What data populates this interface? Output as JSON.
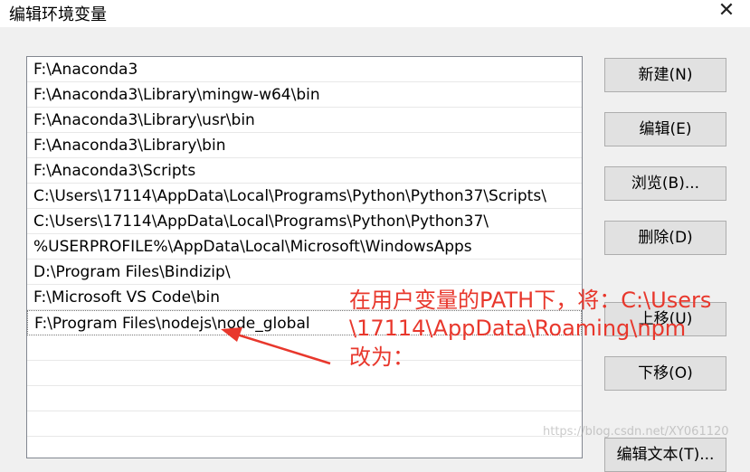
{
  "window": {
    "title": "编辑环境变量",
    "close_glyph": "✕"
  },
  "list": {
    "items": [
      "F:\\Anaconda3",
      "F:\\Anaconda3\\Library\\mingw-w64\\bin",
      "F:\\Anaconda3\\Library\\usr\\bin",
      "F:\\Anaconda3\\Library\\bin",
      "F:\\Anaconda3\\Scripts",
      "C:\\Users\\17114\\AppData\\Local\\Programs\\Python\\Python37\\Scripts\\",
      "C:\\Users\\17114\\AppData\\Local\\Programs\\Python\\Python37\\",
      "%USERPROFILE%\\AppData\\Local\\Microsoft\\WindowsApps",
      "D:\\Program Files\\Bindizip\\",
      "F:\\Microsoft VS Code\\bin",
      "F:\\Program Files\\nodejs\\node_global",
      "",
      "",
      "",
      "",
      ""
    ],
    "selected_index": 10
  },
  "buttons": {
    "new": "新建(N)",
    "edit": "编辑(E)",
    "browse": "浏览(B)...",
    "delete": "删除(D)",
    "move_up": "上移(U)",
    "move_down": "下移(O)",
    "edit_text": "编辑文本(T)..."
  },
  "annotation": {
    "line1": "在用户变量的PATH下，将：C:\\Users",
    "line2": "\\17114\\AppData\\Roaming\\npm",
    "line3": "改为：",
    "color": "#e8372c"
  },
  "watermark": "https://blog.csdn.net/XY061120"
}
